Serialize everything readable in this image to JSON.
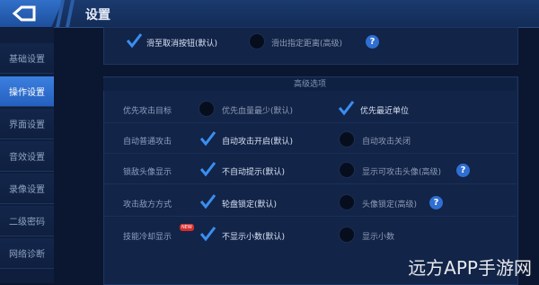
{
  "header": {
    "title": "设置"
  },
  "sidebar": {
    "items": [
      {
        "label": "基础设置"
      },
      {
        "label": "操作设置"
      },
      {
        "label": "界面设置"
      },
      {
        "label": "音效设置"
      },
      {
        "label": "录像设置"
      },
      {
        "label": "二级密码"
      },
      {
        "label": "网络诊断"
      }
    ],
    "active_index": 1
  },
  "top_row": {
    "option_a": "滑至取消按钮(默认)",
    "option_b": "滑出指定距离(高级)"
  },
  "advanced": {
    "section_title": "高级选项",
    "rows": [
      {
        "label": "优先攻击目标",
        "option_a": "优先血量最少(默认)",
        "option_b": "优先最近单位",
        "selected": "b"
      },
      {
        "label": "自动普通攻击",
        "option_a": "自动攻击开启(默认)",
        "option_b": "自动攻击关闭",
        "selected": "a"
      },
      {
        "label": "锁敌头像显示",
        "option_a": "不自动提示(默认)",
        "option_b": "显示可攻击头像(高级)",
        "selected": "a"
      },
      {
        "label": "攻击敌方方式",
        "option_a": "轮盘锁定(默认)",
        "option_b": "头像锁定(高级)",
        "selected": "a"
      },
      {
        "label": "技能冷却显示",
        "option_a": "不显示小数(默认)",
        "option_b": "显示小数",
        "selected": "a"
      }
    ],
    "new_badge": "NEW"
  },
  "watermark": "远方APP手游网",
  "colors": {
    "accent": "#2f6fd2",
    "background": "#0b1630",
    "check": "#3a8ef0"
  },
  "icons": {
    "back": "back-arrow-icon",
    "check": "checkmark-icon",
    "help": "question-icon"
  }
}
